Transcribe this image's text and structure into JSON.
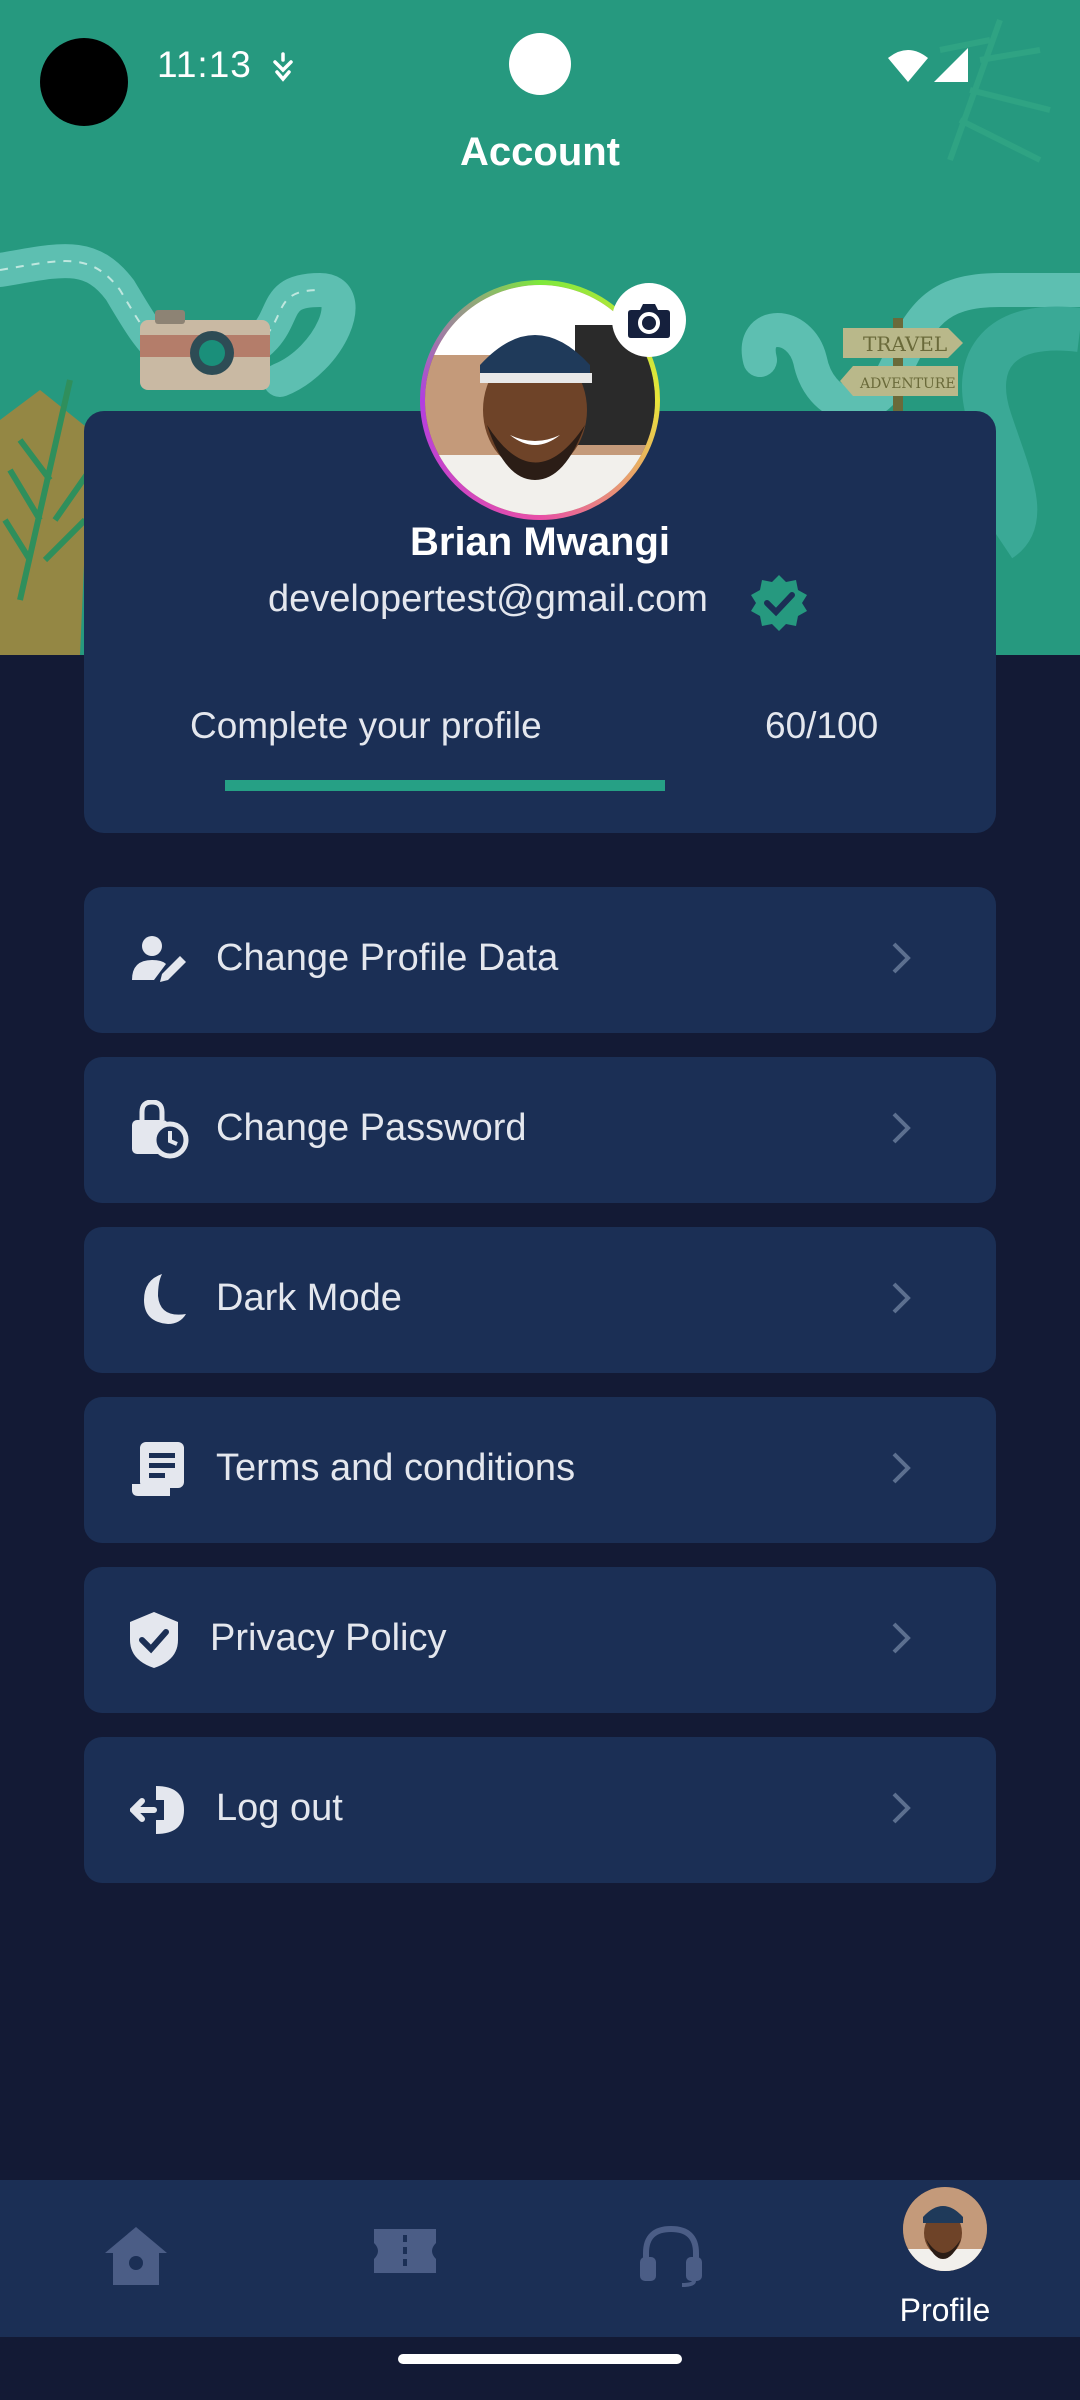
{
  "status_bar": {
    "time": "11:13"
  },
  "header": {
    "title": "Account"
  },
  "profile": {
    "name": "Brian Mwangi",
    "email": "developertest@gmail.com",
    "completion_label": "Complete your profile",
    "score": "60/100",
    "progress": 1.0
  },
  "menu": [
    {
      "label": "Change Profile Data",
      "icon": "user-edit-icon"
    },
    {
      "label": "Change Password",
      "icon": "lock-clock-icon"
    },
    {
      "label": "Dark Mode",
      "icon": "moon-icon"
    },
    {
      "label": "Terms and conditions",
      "icon": "document-icon"
    },
    {
      "label": "Privacy Policy",
      "icon": "shield-check-icon"
    },
    {
      "label": "Log out",
      "icon": "logout-icon"
    }
  ],
  "bottom_nav": [
    {
      "icon": "home-icon",
      "label": ""
    },
    {
      "icon": "ticket-icon",
      "label": ""
    },
    {
      "icon": "headset-icon",
      "label": ""
    },
    {
      "icon": "avatar",
      "label": "Profile",
      "active": true
    }
  ],
  "colors": {
    "accent": "#26997f",
    "background": "#131a35",
    "card": "#1b2f55"
  },
  "decor": {
    "sign_top": "TRAVEL",
    "sign_bottom": "ADVENTURE"
  }
}
